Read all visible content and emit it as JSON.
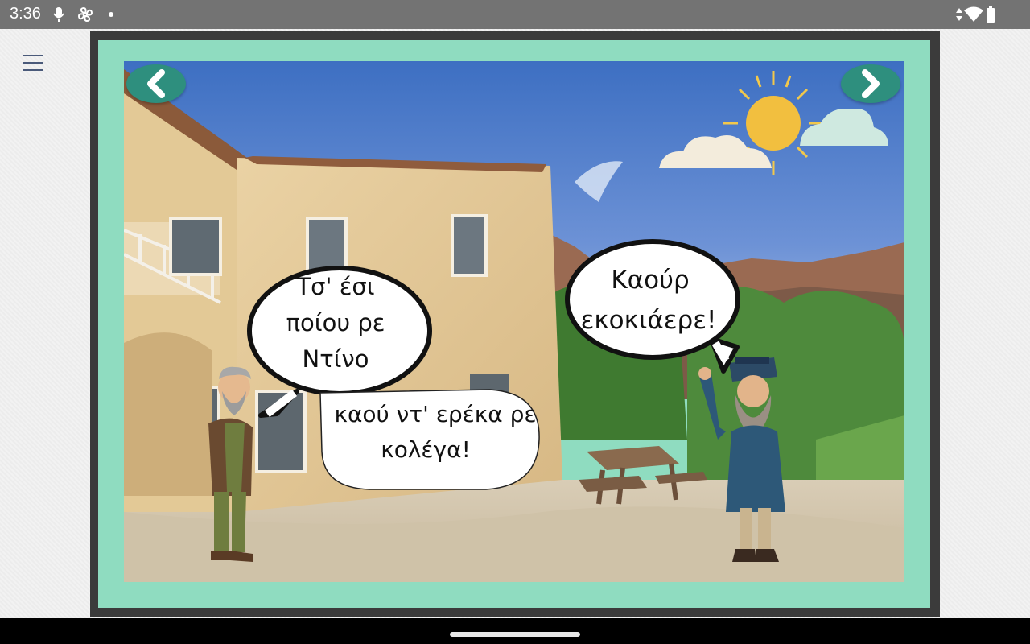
{
  "status_bar": {
    "time": "3:36",
    "icons": [
      "mic-icon",
      "fan-icon",
      "dot-icon",
      "data-arrows-icon",
      "wifi-icon",
      "battery-icon"
    ]
  },
  "menu": {
    "icon": "hamburger-menu-icon"
  },
  "slide": {
    "prev_icon": "chevron-left-icon",
    "next_icon": "chevron-right-icon",
    "bubbles": {
      "left_thought": {
        "line1": "Τσ' έσι",
        "line2": "ποίου ρε",
        "line3": "Ντίνο"
      },
      "left_speech": {
        "line1": "καού ντ' ερέκα ρε",
        "line2": "κολέγα!"
      },
      "right_thought": {
        "line1": "Καούρ",
        "line2": "εκοκιάερε!"
      }
    }
  },
  "colors": {
    "status_bar": "#737373",
    "frame": "#3b3b3b",
    "mint_border": "#8fdcc0",
    "arrow_button": "#2e8f7e"
  }
}
